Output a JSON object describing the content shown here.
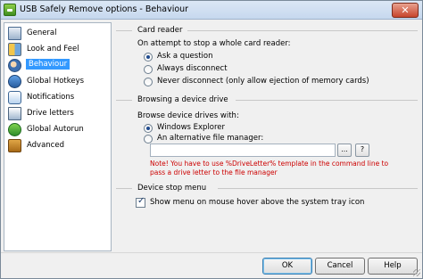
{
  "window": {
    "title": "USB Safely Remove options - Behaviour",
    "close_glyph": "✕"
  },
  "sidebar": {
    "items": [
      {
        "label": "General",
        "icon": "general-icon"
      },
      {
        "label": "Look and Feel",
        "icon": "look-and-feel-icon"
      },
      {
        "label": "Behaviour",
        "icon": "behaviour-icon",
        "selected": true
      },
      {
        "label": "Global Hotkeys",
        "icon": "hotkeys-icon"
      },
      {
        "label": "Notifications",
        "icon": "notifications-icon"
      },
      {
        "label": "Drive letters",
        "icon": "drive-letters-icon"
      },
      {
        "label": "Global Autorun",
        "icon": "autorun-icon"
      },
      {
        "label": "Advanced",
        "icon": "advanced-icon"
      }
    ]
  },
  "card_reader": {
    "heading": "Card reader",
    "prompt": "On attempt to stop a whole card reader:",
    "options": [
      {
        "label": "Ask a question",
        "selected": true
      },
      {
        "label": "Always disconnect",
        "selected": false
      },
      {
        "label": "Never disconnect (only allow ejection of memory cards)",
        "selected": false
      }
    ]
  },
  "browsing": {
    "heading": "Browsing a device drive",
    "prompt": "Browse device drives with:",
    "options": [
      {
        "label": "Windows Explorer",
        "selected": true
      },
      {
        "label": "An alternative file manager:",
        "selected": false
      }
    ],
    "path_value": "",
    "browse_label": "...",
    "help_label": "?",
    "note": "Note! You have to use %DriveLetter% template in the command line to pass a drive letter to the file manager"
  },
  "device_stop_menu": {
    "heading": "Device stop menu",
    "checkbox_label": "Show menu on mouse hover above the system tray icon",
    "checked": true,
    "check_glyph": "✓"
  },
  "buttons": {
    "ok": "OK",
    "cancel": "Cancel",
    "help": "Help"
  },
  "colors": {
    "selection": "#3399ff",
    "note_text": "#cc0000"
  }
}
